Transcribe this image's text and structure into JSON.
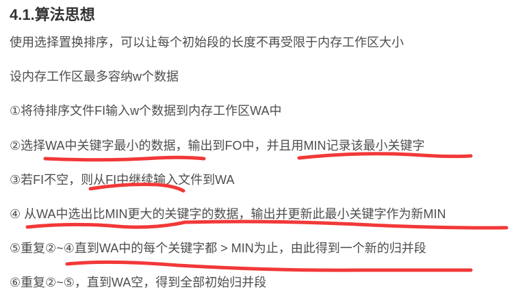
{
  "heading": "4.1.算法思想",
  "paragraphs": [
    "使用选择置换排序，可以让每个初始段的长度不再受限于内存工作区大小",
    "设内存工作区最多容纳w个数据",
    "①将待排序文件FI输入w个数据到内存工作区WA中",
    "②选择WA中关键字最小的数据，输出到FO中，并且用MIN记录该最小关键字",
    "③若FI不空，则从FI中继续输入文件到WA",
    "④ 从WA中选出比MIN更大的关键字的数据，输出并更新此最小关键字作为新MIN",
    "⑤重复②~④直到WA中的每个关键字都 > MIN为止，由此得到一个新的归并段",
    "⑥重复②~⑤，直到WA空，得到全部初始归并段"
  ],
  "annotation_color": "#f23838"
}
